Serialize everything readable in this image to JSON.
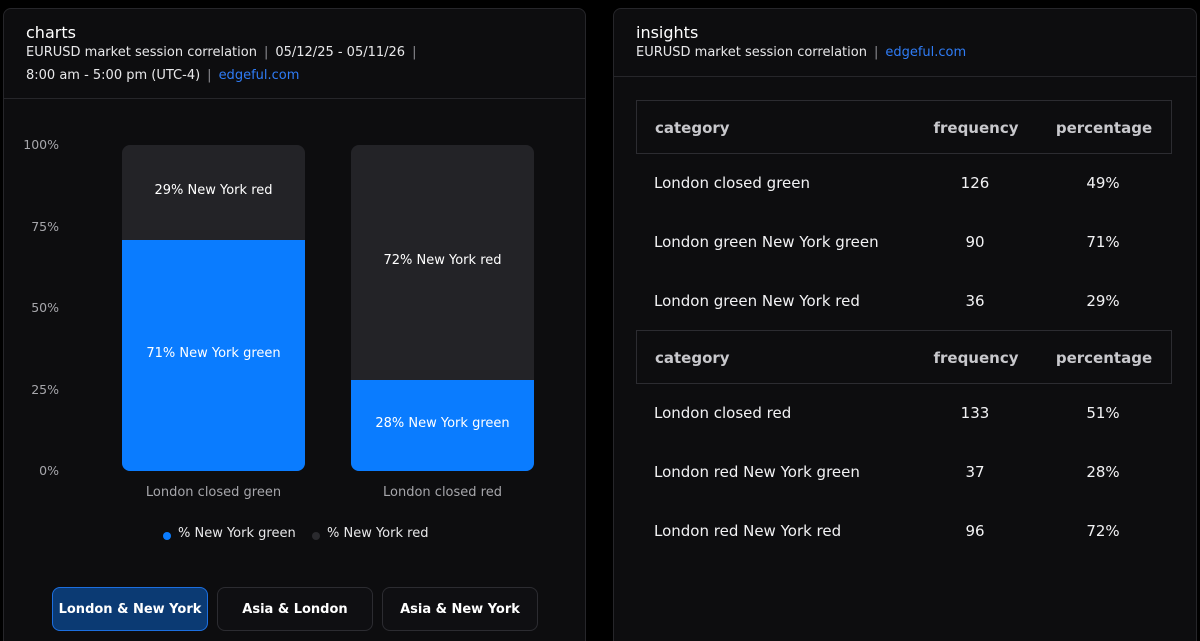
{
  "charts_panel": {
    "title": "charts",
    "subtitle_line1": {
      "instrument": "EURUSD market session correlation",
      "sep": "|",
      "date_range": "05/12/25 - 05/11/26",
      "sep2": "|"
    },
    "subtitle_line2": {
      "hours": "8:00 am - 5:00 pm (UTC-4)",
      "sep": "|",
      "site": "edgeful.com"
    }
  },
  "chart_data": {
    "type": "bar",
    "stacked": true,
    "categories": [
      "London closed green",
      "London closed red"
    ],
    "series": [
      {
        "name": "% New York green",
        "values": [
          71,
          28
        ],
        "labels": [
          "71% New York green",
          "28% New York green"
        ],
        "color": "#0a7cff"
      },
      {
        "name": "% New York red",
        "values": [
          29,
          72
        ],
        "labels": [
          "29% New York red",
          "72% New York red"
        ],
        "color": "#232327"
      }
    ],
    "yticks": [
      "100%",
      "75%",
      "50%",
      "25%",
      "0%"
    ],
    "ylim": [
      0,
      100
    ],
    "legend": "bottom",
    "grid": false
  },
  "tabs": [
    {
      "label": "London & New York",
      "active": true
    },
    {
      "label": "Asia & London",
      "active": false
    },
    {
      "label": "Asia & New York",
      "active": false
    }
  ],
  "insights_panel": {
    "title": "insights",
    "subtitle": {
      "instrument": "EURUSD market session correlation",
      "sep": "|",
      "site": "edgeful.com"
    },
    "tables": [
      {
        "headers": [
          "category",
          "frequency",
          "percentage"
        ],
        "rows": [
          [
            "London closed green",
            "126",
            "49%"
          ],
          [
            "London green New York green",
            "90",
            "71%"
          ],
          [
            "London green New York red",
            "36",
            "29%"
          ]
        ]
      },
      {
        "headers": [
          "category",
          "frequency",
          "percentage"
        ],
        "rows": [
          [
            "London closed red",
            "133",
            "51%"
          ],
          [
            "London red New York green",
            "37",
            "28%"
          ],
          [
            "London red New York red",
            "96",
            "72%"
          ]
        ]
      }
    ]
  },
  "colors": {
    "accent": "#2f7cf6",
    "bar_green": "#0a7cff",
    "bar_red": "#232327",
    "active_tab": "#0b3a73"
  }
}
